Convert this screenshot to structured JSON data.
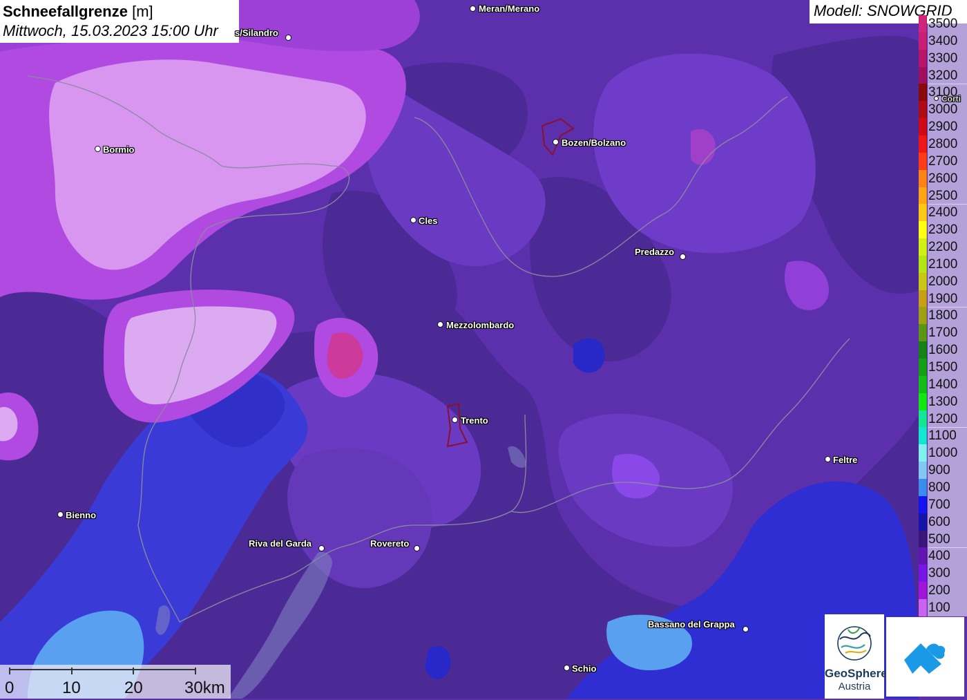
{
  "header": {
    "title_bold": "Schneefallgrenze",
    "title_unit": "[m]",
    "datetime": "Mittwoch, 15.03.2023 15:00 Uhr",
    "model": "Modell: SNOWGRID"
  },
  "legend": {
    "items": [
      {
        "label": "3500",
        "color": "#d0267a"
      },
      {
        "label": "3400",
        "color": "#c81e73"
      },
      {
        "label": "3300",
        "color": "#b8166a"
      },
      {
        "label": "3200",
        "color": "#a00f5e"
      },
      {
        "label": "3100",
        "color": "#8a0a0a"
      },
      {
        "label": "3000",
        "color": "#b00a14"
      },
      {
        "label": "2900",
        "color": "#d00a14"
      },
      {
        "label": "2800",
        "color": "#ee1616"
      },
      {
        "label": "2700",
        "color": "#ff3c14"
      },
      {
        "label": "2600",
        "color": "#ff8214"
      },
      {
        "label": "2500",
        "color": "#ffa514"
      },
      {
        "label": "2400",
        "color": "#ffc814"
      },
      {
        "label": "2300",
        "color": "#ffff14"
      },
      {
        "label": "2200",
        "color": "#d2f014"
      },
      {
        "label": "2100",
        "color": "#b4e614"
      },
      {
        "label": "2000",
        "color": "#c8c814"
      },
      {
        "label": "1900",
        "color": "#c8a014"
      },
      {
        "label": "1800",
        "color": "#a0a014"
      },
      {
        "label": "1700",
        "color": "#5a9614"
      },
      {
        "label": "1600",
        "color": "#148214"
      },
      {
        "label": "1500",
        "color": "#14a014"
      },
      {
        "label": "1400",
        "color": "#14be14"
      },
      {
        "label": "1300",
        "color": "#14e614"
      },
      {
        "label": "1200",
        "color": "#14e696"
      },
      {
        "label": "1100",
        "color": "#14e6d2"
      },
      {
        "label": "1000",
        "color": "#82f0f0"
      },
      {
        "label": "900",
        "color": "#82c8f5"
      },
      {
        "label": "800",
        "color": "#3c8cf0"
      },
      {
        "label": "700",
        "color": "#1414f0"
      },
      {
        "label": "600",
        "color": "#1414aa"
      },
      {
        "label": "500",
        "color": "#3c147a"
      },
      {
        "label": "400",
        "color": "#6414b4"
      },
      {
        "label": "300",
        "color": "#7814e6"
      },
      {
        "label": "200",
        "color": "#a014dc"
      },
      {
        "label": "100",
        "color": "#c864f0"
      }
    ]
  },
  "cities": [
    {
      "name": "Meran/Merano"
    },
    {
      "name": "s/Silandro"
    },
    {
      "name": "Bormio"
    },
    {
      "name": "Bozen/Bolzano"
    },
    {
      "name": "Cles"
    },
    {
      "name": "Predazzo"
    },
    {
      "name": "Mezzolombardo"
    },
    {
      "name": "Trento"
    },
    {
      "name": "Feltre"
    },
    {
      "name": "Bienno"
    },
    {
      "name": "Riva del Garda"
    },
    {
      "name": "Rovereto"
    },
    {
      "name": "Bassano del Grappa"
    },
    {
      "name": "Schio"
    },
    {
      "name": "Corti"
    }
  ],
  "scalebar": {
    "labels": [
      "0",
      "10",
      "20",
      "30km"
    ]
  },
  "logos": {
    "geosphere_line1": "GeoSphere",
    "geosphere_line2": "Austria"
  }
}
